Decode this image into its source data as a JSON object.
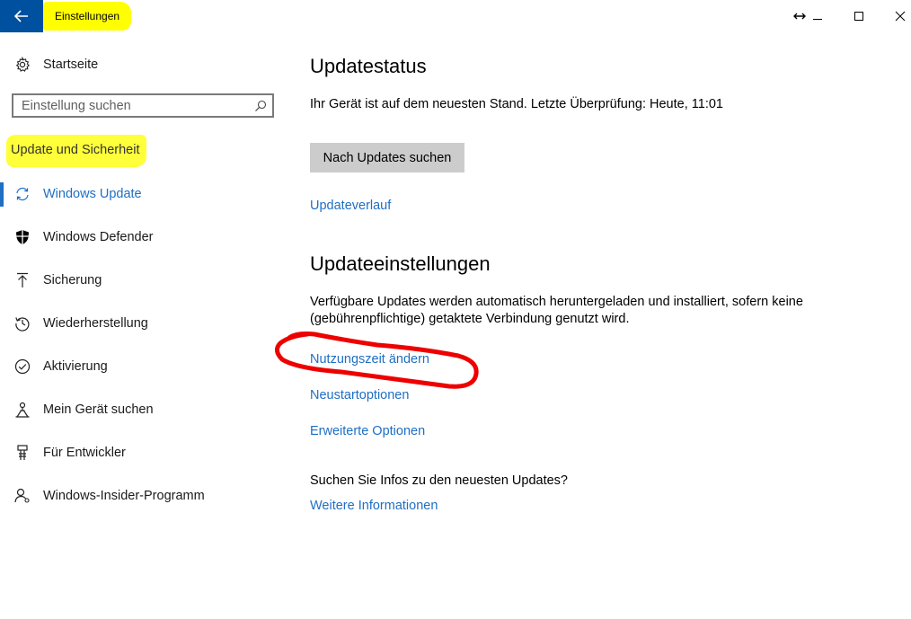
{
  "window": {
    "title": "Einstellungen",
    "accent_color": "#0050a0",
    "highlight_color": "#ffff00"
  },
  "sidebar": {
    "home_label": "Startseite",
    "search_placeholder": "Einstellung suchen",
    "section_title": "Update und Sicherheit",
    "items": [
      {
        "label": "Windows Update",
        "icon": "refresh-icon",
        "active": true
      },
      {
        "label": "Windows Defender",
        "icon": "shield-icon"
      },
      {
        "label": "Sicherung",
        "icon": "upload-arrow-icon"
      },
      {
        "label": "Wiederherstellung",
        "icon": "history-icon"
      },
      {
        "label": "Aktivierung",
        "icon": "checkmark-circle-icon"
      },
      {
        "label": "Mein Gerät suchen",
        "icon": "find-device-icon"
      },
      {
        "label": "Für Entwickler",
        "icon": "developer-icon"
      },
      {
        "label": "Windows-Insider-Programm",
        "icon": "person-icon"
      }
    ]
  },
  "main": {
    "status_heading": "Updatestatus",
    "status_text": "Ihr Gerät ist auf dem neuesten Stand. Letzte Überprüfung: Heute, 11:01",
    "check_button": "Nach Updates suchen",
    "history_link": "Updateverlauf",
    "settings_heading": "Updateeinstellungen",
    "settings_text_line1": "Verfügbare Updates werden automatisch heruntergeladen und installiert, sofern keine",
    "settings_text_line2": "(gebührenpflichtige) getaktete Verbindung genutzt wird.",
    "active_hours_link": "Nutzungszeit ändern",
    "restart_options_link": "Neustartoptionen",
    "advanced_options_link": "Erweiterte Optionen",
    "info_question": "Suchen Sie Infos zu den neuesten Updates?",
    "more_info_link": "Weitere Informationen",
    "link_color": "#1f6fc4",
    "annotation_color": "#ee0000"
  }
}
